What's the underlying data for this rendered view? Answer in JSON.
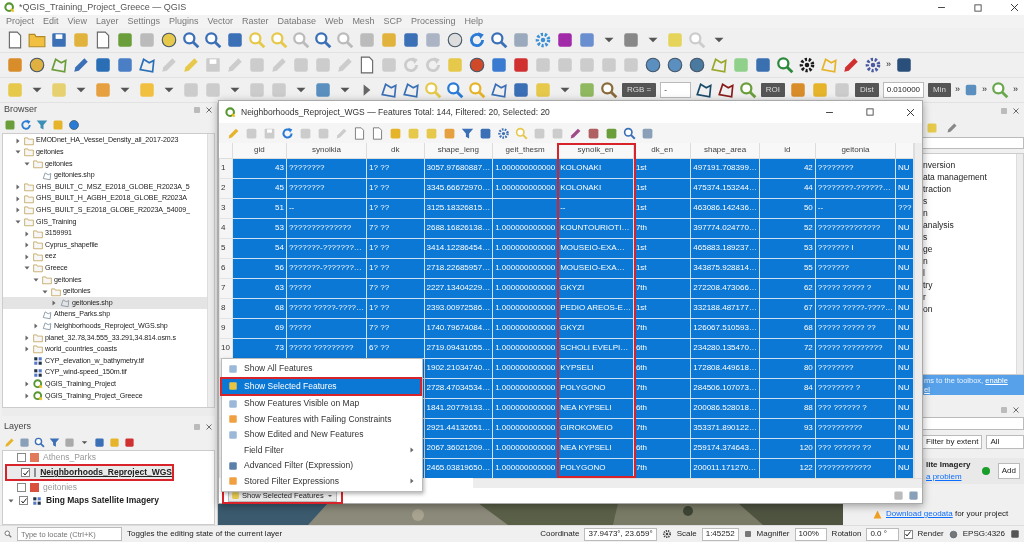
{
  "window": {
    "title": "*QGIS_Training_Project_Greece — QGIS"
  },
  "menu_bar": [
    "Project",
    "Edit",
    "View",
    "Layer",
    "Settings",
    "Plugins",
    "Vector",
    "Raster",
    "Database",
    "Web",
    "Mesh",
    "SCP",
    "Processing",
    "Help"
  ],
  "scp_toolbar": {
    "rgb_label": "RGB =",
    "band": "-",
    "roi_label": "ROI",
    "dist_label": "Dist",
    "dist_value": "0.010000",
    "min_label": "Min"
  },
  "toolbar_overflow": [
    "»",
    "»",
    "»",
    "»"
  ],
  "browser": {
    "title": "Browser",
    "items": [
      {
        "label": "EMODnet_HA_Vessel_Density_all_2017-2023",
        "kind": "folder",
        "expanded": false,
        "selected": false
      },
      {
        "label": "geitonies",
        "kind": "folder",
        "expanded": true,
        "selected": false,
        "children": [
          {
            "label": "geitonies",
            "kind": "folder",
            "expanded": true,
            "selected": false,
            "children": [
              {
                "label": "geitonies.shp",
                "kind": "vector",
                "selected": false
              }
            ]
          }
        ]
      },
      {
        "label": "GHS_BUILT_C_MSZ_E2018_GLOBE_R2023A_5",
        "kind": "folder",
        "expanded": false,
        "selected": false
      },
      {
        "label": "GHS_BUILT_H_AGBH_E2018_GLOBE_R2023A",
        "kind": "folder",
        "expanded": false,
        "selected": false
      },
      {
        "label": "GHS_BUILT_S_E2018_GLOBE_R2023A_54009_",
        "kind": "folder",
        "expanded": false,
        "selected": false
      },
      {
        "label": "GIS_Training",
        "kind": "folder",
        "expanded": true,
        "selected": false,
        "children": [
          {
            "label": "3159991",
            "kind": "folder",
            "expanded": false,
            "selected": false
          },
          {
            "label": "Cyprus_shapefile",
            "kind": "folder",
            "expanded": false,
            "selected": false
          },
          {
            "label": "eez",
            "kind": "folder",
            "expanded": false,
            "selected": false
          },
          {
            "label": "Greece",
            "kind": "folder",
            "expanded": true,
            "selected": false,
            "children": [
              {
                "label": "geitonies",
                "kind": "folder",
                "expanded": true,
                "selected": false,
                "children": [
                  {
                    "label": "geitonies",
                    "kind": "folder",
                    "expanded": true,
                    "selected": false,
                    "children": [
                      {
                        "label": "geitonies.shp",
                        "kind": "vector",
                        "expanded": false,
                        "selected": true
                      }
                    ]
                  }
                ]
              },
              {
                "label": "Athens_Parks.shp",
                "kind": "vector",
                "selected": false
              },
              {
                "label": "Neighborhoods_Reproject_WGS.shp",
                "kind": "vector",
                "expanded": false,
                "selected": false
              }
            ]
          },
          {
            "label": "planet_32.78,34.555_33.291,34.814.osm.s",
            "kind": "folder",
            "expanded": false,
            "selected": false
          },
          {
            "label": "world_countries_coasts",
            "kind": "folder",
            "expanded": false,
            "selected": false
          },
          {
            "label": "CYP_elevation_w_bathymetry.tif",
            "kind": "raster",
            "selected": false
          },
          {
            "label": "CYP_wind-speed_150m.tif",
            "kind": "raster",
            "selected": false
          },
          {
            "label": "QGIS_Training_Project",
            "kind": "project",
            "expanded": false,
            "selected": false
          },
          {
            "label": "QGIS_Training_Project_Greece",
            "kind": "project",
            "expanded": false,
            "selected": false
          }
        ]
      }
    ]
  },
  "layers": {
    "title": "Layers",
    "items": [
      {
        "name": "Athens_Parks",
        "kind": "vector",
        "checked": false,
        "color": "#e07a5a",
        "selected": false,
        "highlighted": false
      },
      {
        "name": "Neighborhoods_Reproject_WGS",
        "kind": "vector",
        "checked": true,
        "color": "#8a9095",
        "selected": true,
        "highlighted": true
      },
      {
        "name": "geitonies",
        "kind": "vector",
        "checked": false,
        "color": "#d9503f",
        "selected": false,
        "highlighted": false
      },
      {
        "name": "Bing Maps Satellite Imagery",
        "kind": "raster",
        "checked": true,
        "expanded": true,
        "selected": false,
        "highlighted": false
      }
    ]
  },
  "attribute_table": {
    "title": "Neighborhoods_Reproject_WGS — Features Total: 144, Filtered: 20, Selected: 20",
    "columns": [
      {
        "label": "gid",
        "kind": "number",
        "highlighted": false
      },
      {
        "label": "synoikia",
        "kind": "text",
        "highlighted": false
      },
      {
        "label": "dk",
        "kind": "text",
        "highlighted": false
      },
      {
        "label": "shape_leng",
        "kind": "text",
        "highlighted": false
      },
      {
        "label": "geit_thesm",
        "kind": "text",
        "highlighted": false
      },
      {
        "label": "synoik_en",
        "kind": "text",
        "highlighted": true
      },
      {
        "label": "dk_en",
        "kind": "text",
        "highlighted": false
      },
      {
        "label": "shape_area",
        "kind": "text",
        "highlighted": false
      },
      {
        "label": "id",
        "kind": "number",
        "highlighted": false
      },
      {
        "label": "geitonia",
        "kind": "text",
        "highlighted": false
      },
      {
        "kind": "text",
        "highlighted": false
      }
    ],
    "rows": [
      {
        "number": "1",
        "selected": true,
        "cells": [
          "43",
          "????????",
          "1? ??",
          "3057.97680887…",
          "1.000000000000",
          "KOLONAKI",
          "1st",
          "497191.708399…",
          "42",
          "????????",
          "NU"
        ]
      },
      {
        "number": "2",
        "selected": true,
        "cells": [
          "45",
          "????????",
          "1? ??",
          "3345.66672970…",
          "1.000000000000",
          "KOLONAKI",
          "1st",
          "475374.153244…",
          "44",
          "????????-??????…",
          "NU"
        ]
      },
      {
        "number": "3",
        "selected": true,
        "cells": [
          "51",
          "--",
          "1? ??",
          "3125.18326815…",
          null,
          "--",
          "1st",
          "463086.142436…",
          "50",
          "--",
          "???"
        ]
      },
      {
        "number": "4",
        "selected": true,
        "cells": [
          "53",
          "??????????????",
          "7? ??",
          "2688.16826138…",
          "1.000000000000",
          "KOUNTOURIOTI…",
          "7th",
          "397774.024770…",
          "52",
          "??????????????",
          "NU"
        ]
      },
      {
        "number": "5",
        "selected": true,
        "cells": [
          "54",
          "???????-???????…",
          "1? ??",
          "3414.12286454…",
          "1.000000000000",
          "MOUSEIO-EXA…",
          "1st",
          "465883.189237…",
          "53",
          "??????? I",
          "NU"
        ]
      },
      {
        "number": "6",
        "selected": true,
        "cells": [
          "56",
          "???????-???????…",
          "1? ??",
          "2718.22685957…",
          "1.000000000000",
          "MOUSEIO-EXA…",
          "1st",
          "343875.928814…",
          "55",
          "???????",
          "NU"
        ]
      },
      {
        "number": "7",
        "selected": true,
        "cells": [
          "63",
          "?????",
          "7? ??",
          "2227.13404229…",
          "1.000000000000",
          "GKYZI",
          "7th",
          "272208.473066…",
          "62",
          "????? ????? ?",
          "NU"
        ]
      },
      {
        "number": "8",
        "selected": true,
        "cells": [
          "68",
          "????? ?????-????…",
          "1? ??",
          "2393.00972586…",
          "1.000000000000",
          "PEDIO AREOS-E…",
          "1st",
          "332188.487177…",
          "67",
          "????? ?????-????…",
          "NU"
        ]
      },
      {
        "number": "9",
        "selected": true,
        "cells": [
          "69",
          "?????",
          "7? ??",
          "1740.79674084…",
          "1.000000000000",
          "GKYZI",
          "7th",
          "126067.510593…",
          "68",
          "????? ????? ??",
          "NU"
        ]
      },
      {
        "number": "10",
        "selected": true,
        "cells": [
          "73",
          "????? ?????????",
          "6? ??",
          "2719.09431055…",
          "1.000000000000",
          "SCHOLI EVELPI…",
          "6th",
          "234280.135470…",
          "72",
          "????? ?????????",
          "NU"
        ]
      },
      {
        "selected": true,
        "cells": [
          "1902.21034740…",
          "1.000000000000",
          "KYPSELI",
          "6th",
          "172808.449618…",
          "80",
          "????????",
          "NU"
        ]
      },
      {
        "selected": true,
        "cells": [
          "2728.47034534…",
          "1.000000000000",
          "POLYGONO",
          "7th",
          "284506.107073…",
          "84",
          "???????? ?",
          "NU"
        ]
      },
      {
        "selected": true,
        "cells": [
          "1841.20779133…",
          "1.000000000000",
          "NEA KYPSELI",
          "6th",
          "200086.528018…",
          "88",
          "??? ?????? ?",
          "NU"
        ]
      },
      {
        "selected": true,
        "cells": [
          "2921.44132651…",
          "1.000000000000",
          "GIROKOMEIO",
          "7th",
          "353371.890122…",
          "93",
          "??????????",
          "NU"
        ]
      },
      {
        "selected": true,
        "cells": [
          "2067.36021209…",
          "1.000000000000",
          "NEA KYPSELI",
          "6th",
          "259174.374643…",
          "120",
          "??? ?????? ??",
          "NU"
        ]
      },
      {
        "selected": true,
        "cells": [
          "2465.03819650…",
          "1.000000000000",
          "POLYGONO",
          "7th",
          "200011.171270…",
          "122",
          "????????????",
          "NU"
        ]
      }
    ],
    "filter_menu": [
      {
        "label": "Show All Features",
        "selected": false,
        "submenu": false,
        "highlighted": false,
        "color": "#9bb8d8"
      },
      {
        "label": "Show Selected Features",
        "selected": true,
        "submenu": false,
        "highlighted": true,
        "color": "#e8c440"
      },
      {
        "label": "Show Features Visible on Map",
        "selected": false,
        "submenu": false,
        "highlighted": false,
        "color": "#9bb8d8"
      },
      {
        "label": "Show Features with Failing Constraints",
        "selected": false,
        "submenu": false,
        "highlighted": false,
        "color": "#f0a040"
      },
      {
        "label": "Show Edited and New Features",
        "selected": false,
        "submenu": false,
        "highlighted": false,
        "color": "#9bb8d8"
      },
      {
        "label": "Field Filter",
        "selected": false,
        "submenu": true,
        "highlighted": false
      },
      {
        "label": "Advanced Filter (Expression)",
        "selected": false,
        "submenu": false,
        "highlighted": false,
        "color": "#5a7fa8"
      },
      {
        "label": "Stored Filter Expressions",
        "selected": false,
        "submenu": true,
        "highlighted": false,
        "color": "#f0a040"
      }
    ],
    "filter_button": {
      "label": "Show Selected Features",
      "highlighted": true
    }
  },
  "processing_toolbox": {
    "items": [
      "nversion",
      "ata management",
      "traction",
      "s",
      "n",
      "analysis",
      "s",
      "ge",
      "n",
      "l",
      "try",
      "r",
      "on"
    ],
    "hint": "ms to the toolbox, ",
    "hint_link": "enable",
    "hint_link_2": "el"
  },
  "resources_panel": {
    "filter_button": "Filter by extent",
    "filter_value": "All",
    "item_title": "lite Imagery",
    "connected": true,
    "add_button": "Add",
    "report_link": "a problem"
  },
  "geodata_notice": {
    "link": "Download geodata",
    "text": " for your project"
  },
  "status_bar": {
    "search_placeholder": "Type to locate (Ctrl+K)",
    "message": "Toggles the editing state of the current layer",
    "coordinate_label": "Coordinate",
    "coordinate": "37.9473°, 23.659°",
    "scale_label": "Scale",
    "scale": "1:45252",
    "magnifier_label": "Magnifier",
    "magnifier": "100%",
    "rotation_label": "Rotation",
    "rotation": "0.0 °",
    "render_label": "Render",
    "render_checked": true,
    "crs": "EPSG:4326"
  }
}
